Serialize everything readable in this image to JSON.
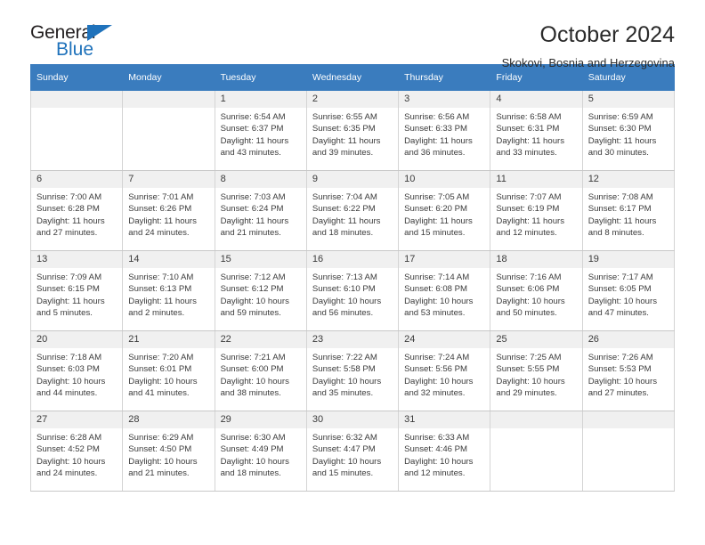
{
  "logo": {
    "word_top": "General",
    "word_bottom": "Blue",
    "triangle_icon": "blue-triangle-icon",
    "accent_color": "#1f72bb"
  },
  "header": {
    "title": "October 2024",
    "subtitle": "Skokovi, Bosnia and Herzegovina"
  },
  "colors": {
    "header_row_bg": "#3a7cbe",
    "day_number_bg": "#f0f0f0",
    "text": "#3b3b3b",
    "grid_line": "#d4d4d4"
  },
  "weekday_headers": [
    "Sunday",
    "Monday",
    "Tuesday",
    "Wednesday",
    "Thursday",
    "Friday",
    "Saturday"
  ],
  "labels": {
    "sunrise_prefix": "Sunrise:",
    "sunset_prefix": "Sunset:",
    "daylight_prefix": "Daylight:"
  },
  "weeks": [
    [
      {
        "day": "",
        "sunrise": "",
        "sunset": "",
        "daylight": "",
        "empty": true
      },
      {
        "day": "",
        "sunrise": "",
        "sunset": "",
        "daylight": "",
        "empty": true
      },
      {
        "day": "1",
        "sunrise": "Sunrise: 6:54 AM",
        "sunset": "Sunset: 6:37 PM",
        "daylight": "Daylight: 11 hours and 43 minutes."
      },
      {
        "day": "2",
        "sunrise": "Sunrise: 6:55 AM",
        "sunset": "Sunset: 6:35 PM",
        "daylight": "Daylight: 11 hours and 39 minutes."
      },
      {
        "day": "3",
        "sunrise": "Sunrise: 6:56 AM",
        "sunset": "Sunset: 6:33 PM",
        "daylight": "Daylight: 11 hours and 36 minutes."
      },
      {
        "day": "4",
        "sunrise": "Sunrise: 6:58 AM",
        "sunset": "Sunset: 6:31 PM",
        "daylight": "Daylight: 11 hours and 33 minutes."
      },
      {
        "day": "5",
        "sunrise": "Sunrise: 6:59 AM",
        "sunset": "Sunset: 6:30 PM",
        "daylight": "Daylight: 11 hours and 30 minutes."
      }
    ],
    [
      {
        "day": "6",
        "sunrise": "Sunrise: 7:00 AM",
        "sunset": "Sunset: 6:28 PM",
        "daylight": "Daylight: 11 hours and 27 minutes."
      },
      {
        "day": "7",
        "sunrise": "Sunrise: 7:01 AM",
        "sunset": "Sunset: 6:26 PM",
        "daylight": "Daylight: 11 hours and 24 minutes."
      },
      {
        "day": "8",
        "sunrise": "Sunrise: 7:03 AM",
        "sunset": "Sunset: 6:24 PM",
        "daylight": "Daylight: 11 hours and 21 minutes."
      },
      {
        "day": "9",
        "sunrise": "Sunrise: 7:04 AM",
        "sunset": "Sunset: 6:22 PM",
        "daylight": "Daylight: 11 hours and 18 minutes."
      },
      {
        "day": "10",
        "sunrise": "Sunrise: 7:05 AM",
        "sunset": "Sunset: 6:20 PM",
        "daylight": "Daylight: 11 hours and 15 minutes."
      },
      {
        "day": "11",
        "sunrise": "Sunrise: 7:07 AM",
        "sunset": "Sunset: 6:19 PM",
        "daylight": "Daylight: 11 hours and 12 minutes."
      },
      {
        "day": "12",
        "sunrise": "Sunrise: 7:08 AM",
        "sunset": "Sunset: 6:17 PM",
        "daylight": "Daylight: 11 hours and 8 minutes."
      }
    ],
    [
      {
        "day": "13",
        "sunrise": "Sunrise: 7:09 AM",
        "sunset": "Sunset: 6:15 PM",
        "daylight": "Daylight: 11 hours and 5 minutes."
      },
      {
        "day": "14",
        "sunrise": "Sunrise: 7:10 AM",
        "sunset": "Sunset: 6:13 PM",
        "daylight": "Daylight: 11 hours and 2 minutes."
      },
      {
        "day": "15",
        "sunrise": "Sunrise: 7:12 AM",
        "sunset": "Sunset: 6:12 PM",
        "daylight": "Daylight: 10 hours and 59 minutes."
      },
      {
        "day": "16",
        "sunrise": "Sunrise: 7:13 AM",
        "sunset": "Sunset: 6:10 PM",
        "daylight": "Daylight: 10 hours and 56 minutes."
      },
      {
        "day": "17",
        "sunrise": "Sunrise: 7:14 AM",
        "sunset": "Sunset: 6:08 PM",
        "daylight": "Daylight: 10 hours and 53 minutes."
      },
      {
        "day": "18",
        "sunrise": "Sunrise: 7:16 AM",
        "sunset": "Sunset: 6:06 PM",
        "daylight": "Daylight: 10 hours and 50 minutes."
      },
      {
        "day": "19",
        "sunrise": "Sunrise: 7:17 AM",
        "sunset": "Sunset: 6:05 PM",
        "daylight": "Daylight: 10 hours and 47 minutes."
      }
    ],
    [
      {
        "day": "20",
        "sunrise": "Sunrise: 7:18 AM",
        "sunset": "Sunset: 6:03 PM",
        "daylight": "Daylight: 10 hours and 44 minutes."
      },
      {
        "day": "21",
        "sunrise": "Sunrise: 7:20 AM",
        "sunset": "Sunset: 6:01 PM",
        "daylight": "Daylight: 10 hours and 41 minutes."
      },
      {
        "day": "22",
        "sunrise": "Sunrise: 7:21 AM",
        "sunset": "Sunset: 6:00 PM",
        "daylight": "Daylight: 10 hours and 38 minutes."
      },
      {
        "day": "23",
        "sunrise": "Sunrise: 7:22 AM",
        "sunset": "Sunset: 5:58 PM",
        "daylight": "Daylight: 10 hours and 35 minutes."
      },
      {
        "day": "24",
        "sunrise": "Sunrise: 7:24 AM",
        "sunset": "Sunset: 5:56 PM",
        "daylight": "Daylight: 10 hours and 32 minutes."
      },
      {
        "day": "25",
        "sunrise": "Sunrise: 7:25 AM",
        "sunset": "Sunset: 5:55 PM",
        "daylight": "Daylight: 10 hours and 29 minutes."
      },
      {
        "day": "26",
        "sunrise": "Sunrise: 7:26 AM",
        "sunset": "Sunset: 5:53 PM",
        "daylight": "Daylight: 10 hours and 27 minutes."
      }
    ],
    [
      {
        "day": "27",
        "sunrise": "Sunrise: 6:28 AM",
        "sunset": "Sunset: 4:52 PM",
        "daylight": "Daylight: 10 hours and 24 minutes."
      },
      {
        "day": "28",
        "sunrise": "Sunrise: 6:29 AM",
        "sunset": "Sunset: 4:50 PM",
        "daylight": "Daylight: 10 hours and 21 minutes."
      },
      {
        "day": "29",
        "sunrise": "Sunrise: 6:30 AM",
        "sunset": "Sunset: 4:49 PM",
        "daylight": "Daylight: 10 hours and 18 minutes."
      },
      {
        "day": "30",
        "sunrise": "Sunrise: 6:32 AM",
        "sunset": "Sunset: 4:47 PM",
        "daylight": "Daylight: 10 hours and 15 minutes."
      },
      {
        "day": "31",
        "sunrise": "Sunrise: 6:33 AM",
        "sunset": "Sunset: 4:46 PM",
        "daylight": "Daylight: 10 hours and 12 minutes."
      },
      {
        "day": "",
        "sunrise": "",
        "sunset": "",
        "daylight": "",
        "empty": true
      },
      {
        "day": "",
        "sunrise": "",
        "sunset": "",
        "daylight": "",
        "empty": true
      }
    ]
  ]
}
